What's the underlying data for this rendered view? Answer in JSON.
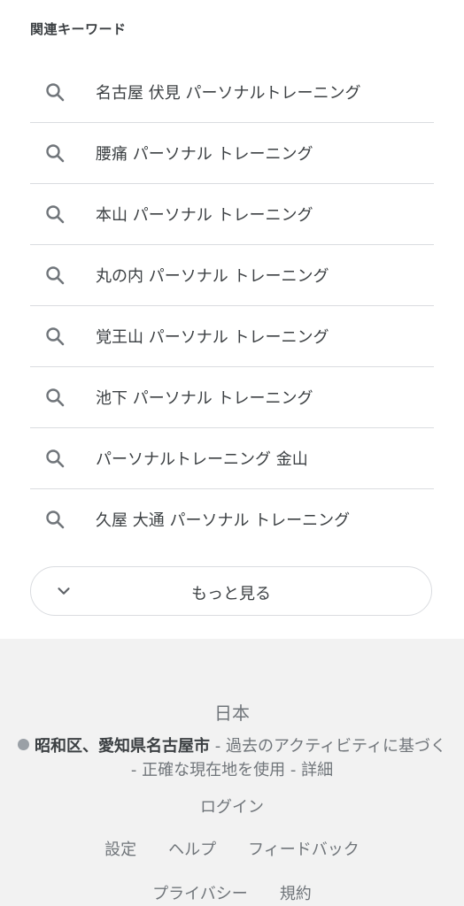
{
  "related": {
    "title": "関連キーワード",
    "items": [
      {
        "label": "名古屋 伏見 パーソナルトレーニング",
        "icon": "search-icon"
      },
      {
        "label": "腰痛 パーソナル トレーニング",
        "icon": "search-icon"
      },
      {
        "label": "本山 パーソナル トレーニング",
        "icon": "search-icon"
      },
      {
        "label": "丸の内 パーソナル トレーニング",
        "icon": "search-icon"
      },
      {
        "label": "覚王山 パーソナル トレーニング",
        "icon": "search-icon"
      },
      {
        "label": "池下 パーソナル トレーニング",
        "icon": "search-icon"
      },
      {
        "label": "パーソナルトレーニング 金山",
        "icon": "search-icon"
      },
      {
        "label": "久屋 大通 パーソナル トレーニング",
        "icon": "search-icon"
      }
    ],
    "more_label": "もっと見る"
  },
  "footer": {
    "country": "日本",
    "location_place": "昭和区、愛知県名古屋市",
    "location_sep1": " - ",
    "location_source": "過去のアクティビティに基づく",
    "location_sep2": " - ",
    "location_precise": "正確な現在地を使用",
    "location_sep3": " - ",
    "location_details": "詳細",
    "login": "ログイン",
    "links": [
      "設定",
      "ヘルプ",
      "フィードバック"
    ],
    "links2": [
      "プライバシー",
      "規約"
    ]
  },
  "colors": {
    "text": "#3c4043",
    "muted": "#70757a",
    "divider": "#dadce0",
    "footer_bg": "#f2f2f2"
  }
}
